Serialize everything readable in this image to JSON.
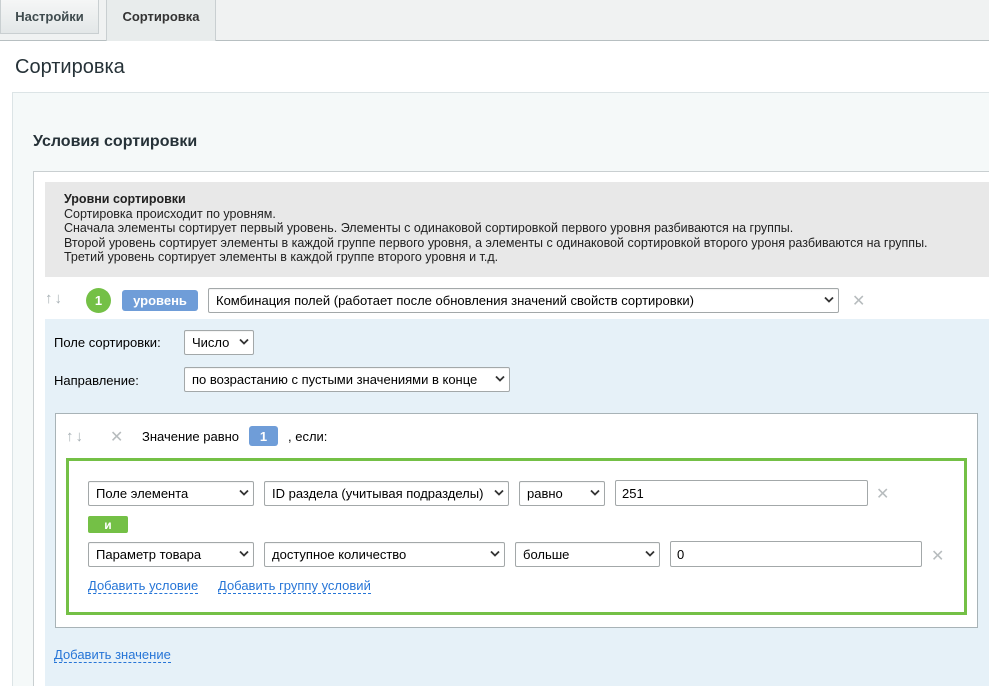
{
  "tabs": [
    {
      "label": "Настройки",
      "active": false
    },
    {
      "label": "Сортировка",
      "active": true
    }
  ],
  "page_title": "Сортировка",
  "section_title": "Условия сортировки",
  "info": {
    "title": "Уровни сортировки",
    "lines": [
      "Сортировка происходит по уровням.",
      "Сначала элементы сортирует первый уровень. Элементы с одинаковой сортировкой первого уровня разбиваются на группы.",
      "Второй уровень сортирует элементы в каждой группе первого уровня, а элементы с одинаковой сортировкой второго уроня разбиваются на группы.",
      "Третий уровень сортирует элементы в каждой группе второго уровня и т.д."
    ]
  },
  "level": {
    "number": "1",
    "badge": "уровень",
    "mode_select": "Комбинация полей (работает после обновления значений свойств сортировки)",
    "sort_field_label": "Поле сортировки:",
    "sort_field_select": "Число",
    "direction_label": "Направление:",
    "direction_select": "по возрастанию с пустыми значениями в конце"
  },
  "value_block": {
    "label_before": "Значение равно",
    "value": "1",
    "label_after": ", если:"
  },
  "conditions": [
    {
      "field_type": "Поле элемента",
      "field": "ID раздела (учитывая подразделы)",
      "operator": "равно",
      "value": "251"
    },
    {
      "field_type": "Параметр товара",
      "field": "доступное количество",
      "operator": "больше",
      "value": "0"
    }
  ],
  "and_label": "и",
  "links": {
    "add_condition": "Добавить условие",
    "add_group": "Добавить группу условий",
    "add_value": "Добавить значение"
  },
  "icons": {
    "up_down": "up-down-arrows-icon",
    "remove": "close-icon",
    "dropdown": "chevron-down-icon"
  },
  "colors": {
    "accent_green": "#74c046",
    "accent_blue": "#6f9dd8",
    "link_blue": "#2675d7",
    "level_bg": "#e6f1f8"
  }
}
